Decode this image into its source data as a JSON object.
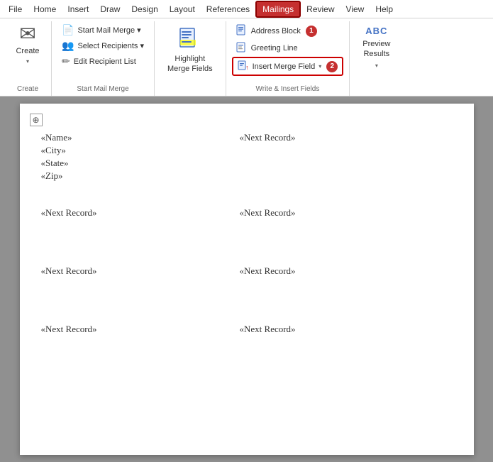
{
  "menu": {
    "items": [
      {
        "id": "file",
        "label": "File"
      },
      {
        "id": "home",
        "label": "Home"
      },
      {
        "id": "insert",
        "label": "Insert"
      },
      {
        "id": "draw",
        "label": "Draw"
      },
      {
        "id": "design",
        "label": "Design"
      },
      {
        "id": "layout",
        "label": "Layout"
      },
      {
        "id": "references",
        "label": "References"
      },
      {
        "id": "mailings",
        "label": "Mailings"
      },
      {
        "id": "review",
        "label": "Review"
      },
      {
        "id": "view",
        "label": "View"
      },
      {
        "id": "help",
        "label": "Help"
      }
    ],
    "active": "Mailings"
  },
  "ribbon": {
    "groups": [
      {
        "id": "create",
        "label": "Create",
        "buttons": [
          {
            "id": "create-btn",
            "label": "Create",
            "icon": "✉"
          }
        ]
      },
      {
        "id": "start-mail-merge",
        "label": "Start Mail Merge",
        "buttons": [
          {
            "id": "start-mail-merge-btn",
            "label": "Start Mail Merge",
            "icon": "📄",
            "dropdown": true
          },
          {
            "id": "select-recipients-btn",
            "label": "Select Recipients",
            "icon": "👥",
            "dropdown": true
          },
          {
            "id": "edit-recipient-list-btn",
            "label": "Edit Recipient List",
            "icon": "✏️"
          }
        ]
      },
      {
        "id": "highlight-merge-fields",
        "label": "Highlight\nMerge Fields",
        "icon": "📄"
      },
      {
        "id": "write-insert-fields",
        "label": "Write & Insert Fields",
        "buttons": [
          {
            "id": "address-block-btn",
            "label": "Address Block",
            "icon": "📋",
            "badge": "1"
          },
          {
            "id": "greeting-line-btn",
            "label": "Greeting Line",
            "icon": "📝"
          },
          {
            "id": "insert-merge-field-btn",
            "label": "Insert Merge Field",
            "icon": "📄",
            "dropdown": true,
            "red-outline": true,
            "badge": "2"
          }
        ]
      },
      {
        "id": "preview-results",
        "label": "Preview\nResults",
        "icon": "ABC",
        "dropdown": true
      }
    ]
  },
  "document": {
    "fields": {
      "name": "«Name»",
      "city": "«City»",
      "state": "«State»",
      "zip": "«Zip»",
      "next_record": "«Next Record»"
    },
    "sections": [
      {
        "left": "«Name»\n«City»\n«State»\n«Zip»",
        "right": "«Next Record»"
      },
      {
        "left": "«Next Record»",
        "right": "«Next Record»"
      },
      {
        "left": "«Next Record»",
        "right": "«Next Record»"
      },
      {
        "left": "«Next Record»",
        "right": "«Next Record»"
      }
    ]
  },
  "icons": {
    "move": "⊕",
    "envelope": "✉",
    "document": "📄",
    "people": "👤",
    "edit": "✏",
    "address": "📋",
    "letter": "📝",
    "insert-field": "🔗",
    "preview": "🔠",
    "dropdown-arrow": "▾"
  },
  "labels": {
    "create": "Create",
    "start_mail_merge_group": "Start Mail Merge",
    "write_insert_group": "Write & Insert Fields",
    "start_mail_merge": "Start Mail Merge ▾",
    "select_recipients": "Select Recipients ▾",
    "edit_recipient_list": "Edit Recipient List",
    "highlight_merge_fields": "Highlight\nMerge Fields",
    "address_block": "Address Block",
    "greeting_line": "Greeting Line",
    "insert_merge_field": "Insert Merge Field",
    "preview_results": "Preview\nResults",
    "abc": "ABC"
  }
}
